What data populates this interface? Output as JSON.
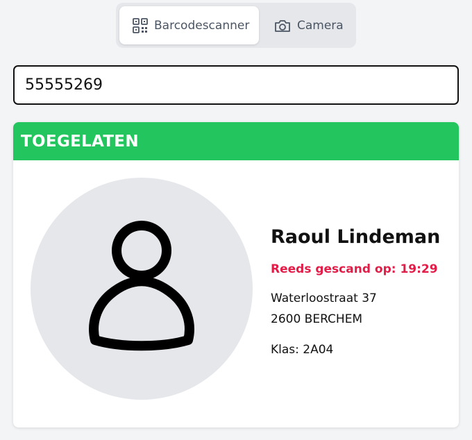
{
  "mode_switch": {
    "options": [
      {
        "label": "Barcodescanner",
        "icon": "qr-code-icon",
        "active": true
      },
      {
        "label": "Camera",
        "icon": "camera-icon",
        "active": false
      }
    ]
  },
  "barcode_input": {
    "value": "55555269"
  },
  "result": {
    "status": "TOEGELATEN",
    "status_color": "#22c55e",
    "avatar_icon": "user-icon",
    "name": "Raoul Lindeman",
    "scan_note": "Reeds gescand op: 19:29",
    "scan_note_color": "#e11d48",
    "address_line1": "Waterloostraat 37",
    "address_line2": "2600 BERCHEM",
    "class_label": "Klas: 2A04"
  }
}
